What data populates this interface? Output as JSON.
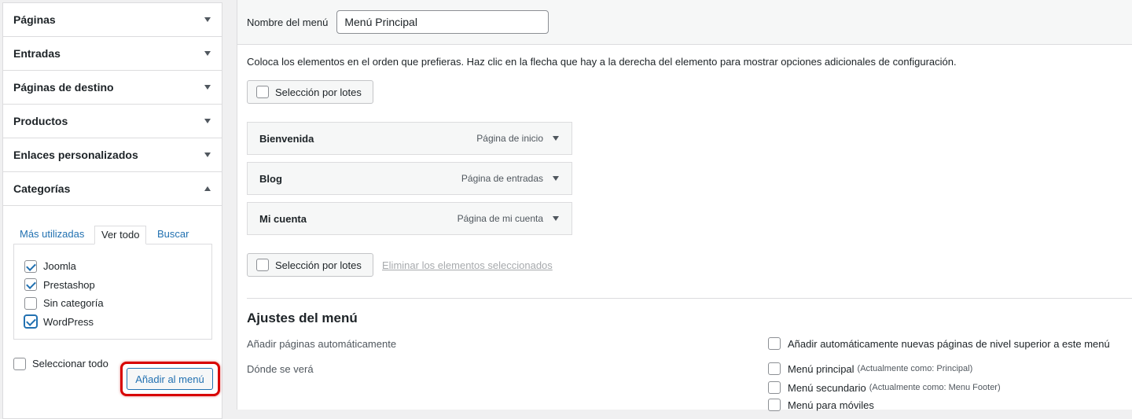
{
  "sidebar": {
    "sections": [
      {
        "title": "Páginas"
      },
      {
        "title": "Entradas"
      },
      {
        "title": "Páginas de destino"
      },
      {
        "title": "Productos"
      },
      {
        "title": "Enlaces personalizados"
      },
      {
        "title": "Categorías"
      }
    ],
    "categories": {
      "tabs": [
        "Más utilizadas",
        "Ver todo",
        "Buscar"
      ],
      "active_tab": "Ver todo",
      "items": [
        {
          "label": "Joomla",
          "checked": true
        },
        {
          "label": "Prestashop",
          "checked": true
        },
        {
          "label": "Sin categoría",
          "checked": false
        },
        {
          "label": "WordPress",
          "checked": true
        }
      ],
      "select_all_label": "Seleccionar todo",
      "add_button_label": "Añadir al menú"
    }
  },
  "main": {
    "menu_name_label": "Nombre del menú",
    "menu_name_value": "Menú Principal",
    "instructions": "Coloca los elementos en el orden que prefieras. Haz clic en la flecha que hay a la derecha del elemento para mostrar opciones adicionales de configuración.",
    "bulk_select_label": "Selección por lotes",
    "menu_items": [
      {
        "title": "Bienvenida",
        "type": "Página de inicio"
      },
      {
        "title": "Blog",
        "type": "Página de entradas"
      },
      {
        "title": "Mi cuenta",
        "type": "Página de mi cuenta"
      }
    ],
    "delete_selected_label": "Eliminar los elementos seleccionados",
    "settings": {
      "title": "Ajustes del menú",
      "auto_add_label": "Añadir páginas automáticamente",
      "auto_add_option": "Añadir automáticamente nuevas páginas de nivel superior a este menú",
      "locations_label": "Dónde se verá",
      "locations": [
        {
          "label": "Menú principal",
          "note": "(Actualmente como: Principal)"
        },
        {
          "label": "Menú secundario",
          "note": "(Actualmente como: Menu Footer)"
        },
        {
          "label": "Menú para móviles",
          "note": ""
        }
      ]
    }
  },
  "colors": {
    "link": "#2271b1",
    "highlight_border": "#d80000",
    "panel_bg": "#f6f7f7",
    "border": "#dcdcde"
  }
}
